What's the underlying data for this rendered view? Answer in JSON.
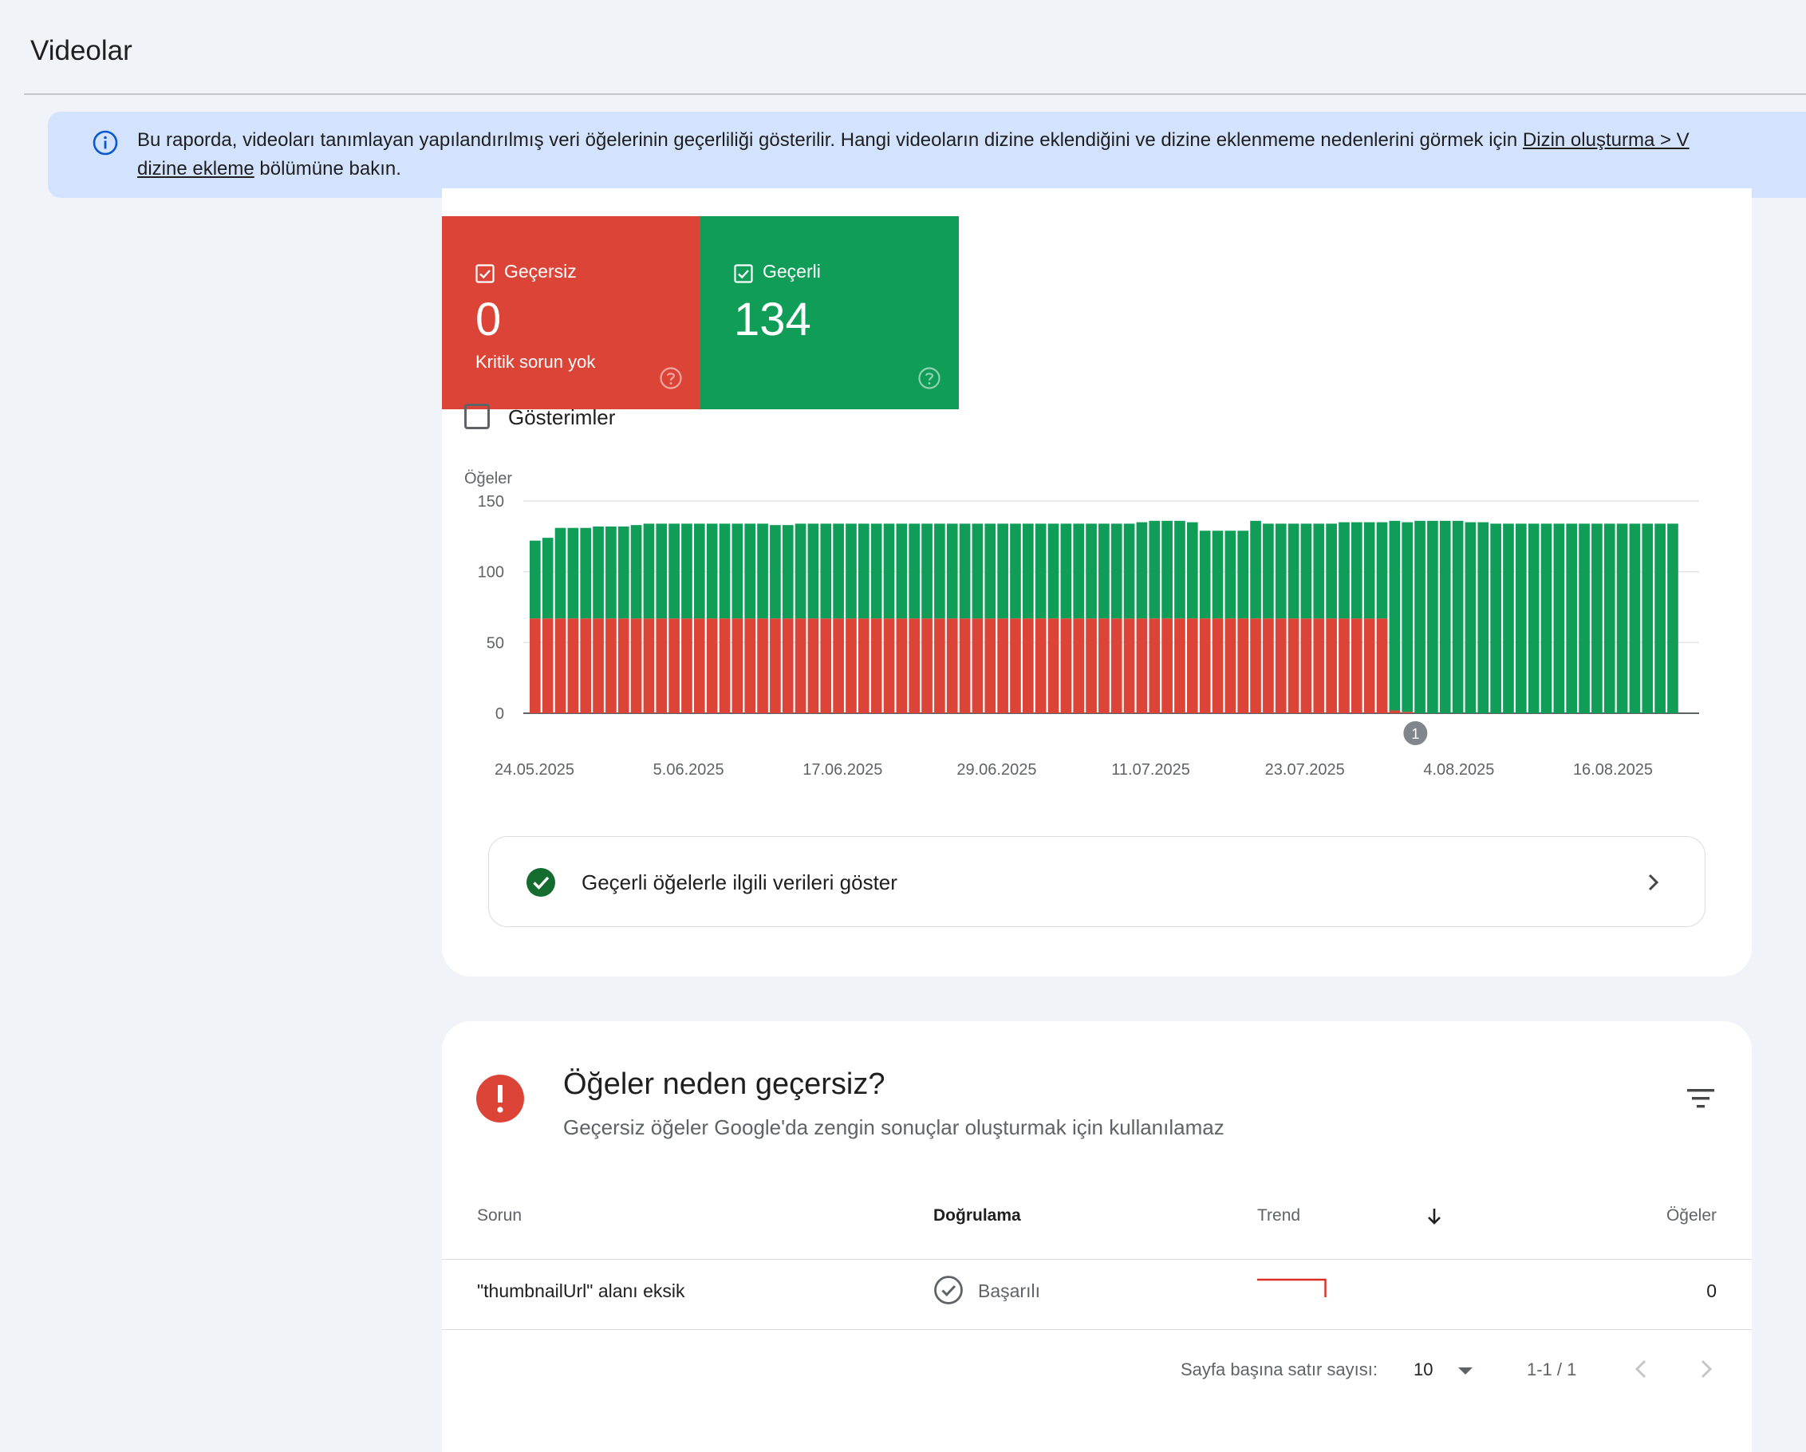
{
  "page": {
    "title": "Videolar"
  },
  "banner": {
    "text_before": "Bu raporda, videoları tanımlayan yapılandırılmış veri öğelerinin geçerliliği gösterilir. Hangi videoların dizine eklendiğini ve dizine eklenmeme nedenlerini görmek için ",
    "link1": "Dizin oluşturma > V",
    "link2": "dizine ekleme",
    "text_after": " bölümüne bakın."
  },
  "tiles": {
    "invalid": {
      "label": "Geçersiz",
      "value": "0",
      "sub": "Kritik sorun yok",
      "color": "#db4437"
    },
    "valid": {
      "label": "Geçerli",
      "value": "134",
      "color": "#0f9d58"
    }
  },
  "impressions": {
    "label": "Gösterimler"
  },
  "chart_data": {
    "type": "bar",
    "stacked": true,
    "ylabel": "Öğeler",
    "ylim": [
      0,
      150
    ],
    "yticks": [
      0,
      50,
      100,
      150
    ],
    "xtick_labels": [
      "24.05.2025",
      "5.06.2025",
      "17.06.2025",
      "29.06.2025",
      "11.07.2025",
      "23.07.2025",
      "4.08.2025",
      "16.08.2025"
    ],
    "annotation": {
      "label": "1",
      "bar_index": 68
    },
    "series": [
      {
        "name": "Geçersiz",
        "color": "#db4437",
        "values": [
          67,
          67,
          67,
          67,
          67,
          67,
          67,
          67,
          67,
          67,
          67,
          67,
          67,
          67,
          67,
          67,
          67,
          67,
          67,
          67,
          67,
          67,
          67,
          67,
          67,
          67,
          67,
          67,
          67,
          67,
          67,
          67,
          67,
          67,
          67,
          67,
          67,
          67,
          67,
          67,
          67,
          67,
          67,
          67,
          67,
          67,
          67,
          67,
          67,
          67,
          67,
          67,
          67,
          67,
          67,
          67,
          67,
          67,
          67,
          67,
          67,
          67,
          67,
          67,
          67,
          67,
          67,
          67,
          2,
          1,
          0,
          0,
          0,
          0,
          0,
          0,
          0,
          0,
          0,
          0,
          0,
          0,
          0,
          0,
          0,
          0,
          0,
          0,
          0,
          0,
          0
        ]
      },
      {
        "name": "Geçerli",
        "color": "#0f9d58",
        "values": [
          55,
          57,
          64,
          64,
          64,
          65,
          65,
          65,
          66,
          67,
          67,
          67,
          67,
          67,
          67,
          67,
          67,
          67,
          67,
          66,
          66,
          67,
          67,
          67,
          67,
          67,
          67,
          67,
          67,
          67,
          67,
          67,
          67,
          67,
          67,
          67,
          67,
          67,
          67,
          67,
          67,
          67,
          67,
          67,
          67,
          67,
          67,
          67,
          68,
          69,
          69,
          69,
          68,
          62,
          62,
          62,
          62,
          69,
          67,
          67,
          67,
          67,
          67,
          67,
          68,
          68,
          68,
          68,
          134,
          134,
          136,
          136,
          136,
          136,
          135,
          135,
          134,
          134,
          134,
          134,
          134,
          134,
          134,
          134,
          134,
          134,
          134,
          134,
          134,
          134,
          134
        ]
      }
    ]
  },
  "show_valid": {
    "label": "Geçerli öğelerle ilgili verileri göster"
  },
  "issues": {
    "title": "Öğeler neden geçersiz?",
    "subtitle": "Geçersiz öğeler Google'da zengin sonuçlar oluşturmak için kullanılamaz",
    "columns": {
      "issue": "Sorun",
      "validation": "Doğrulama",
      "trend": "Trend",
      "items": "Öğeler"
    },
    "rows": [
      {
        "issue": "\"thumbnailUrl\" alanı eksik",
        "validation": "Başarılı",
        "trend": [
          67,
          67,
          67,
          67,
          0
        ],
        "items": "0"
      }
    ],
    "pager": {
      "rows_label": "Sayfa başına satır sayısı:",
      "rows_value": "10",
      "range": "1-1 / 1"
    }
  }
}
